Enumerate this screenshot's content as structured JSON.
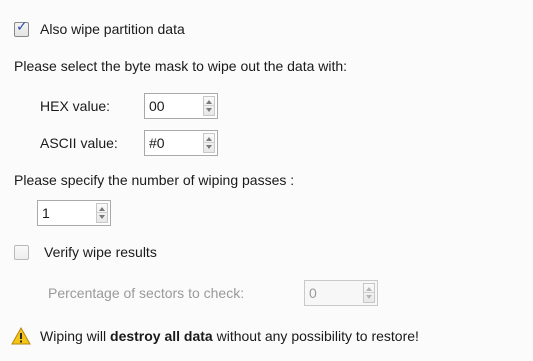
{
  "wipe_partition": {
    "label": "Also wipe partition data",
    "checked": true
  },
  "byte_mask_prompt": "Please select the byte mask to wipe out the data with:",
  "hex": {
    "label": "HEX value:",
    "value": "00"
  },
  "ascii": {
    "label": "ASCII value:",
    "value": "#0"
  },
  "passes_prompt": "Please specify the number of wiping passes :",
  "passes": {
    "value": "1"
  },
  "verify": {
    "label": "Verify wipe results",
    "checked": false
  },
  "percentage": {
    "label": "Percentage of sectors to check:",
    "value": "0",
    "enabled": false
  },
  "warning": {
    "prefix": "Wiping will ",
    "bold": "destroy all data",
    "suffix": " without any possibility to restore!",
    "icon": "warning-icon"
  }
}
